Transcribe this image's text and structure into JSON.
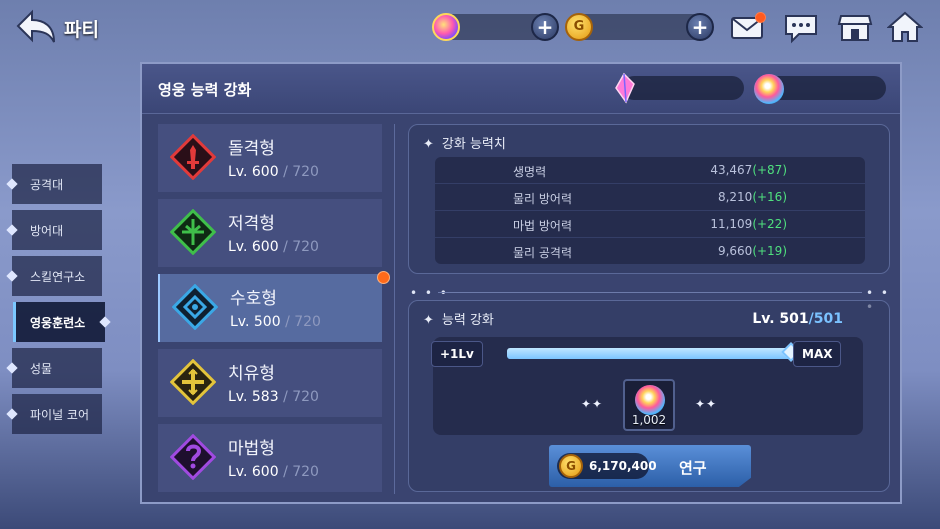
{
  "header": {
    "title": "파티",
    "currency_gold_icon": "G",
    "icons": [
      "back-arrow-icon",
      "gem-icon",
      "gold-coin-icon",
      "mail-icon",
      "chat-icon",
      "shop-icon",
      "home-icon"
    ]
  },
  "sidebar": {
    "items": [
      {
        "label": "공격대"
      },
      {
        "label": "방어대"
      },
      {
        "label": "스킬연구소"
      },
      {
        "label": "영웅훈련소",
        "active": true
      },
      {
        "label": "성물"
      },
      {
        "label": "파이널 코어"
      }
    ]
  },
  "panel": {
    "title": "영웅 능력 강화"
  },
  "classes": [
    {
      "name": "돌격형",
      "lv_prefix": "Lv. 600",
      "lv_max": " / 720",
      "icon": "sword-icon",
      "color": "#e23a3a"
    },
    {
      "name": "저격형",
      "lv_prefix": "Lv. 600",
      "lv_max": " / 720",
      "icon": "crosshair-icon",
      "color": "#3fbf4a"
    },
    {
      "name": "수호형",
      "lv_prefix": "Lv. 500",
      "lv_max": " / 720",
      "icon": "shield-icon",
      "color": "#3aa8e6",
      "active": true,
      "badge": true
    },
    {
      "name": "치유형",
      "lv_prefix": "Lv. 583",
      "lv_max": " / 720",
      "icon": "cross-icon",
      "color": "#e3c43b"
    },
    {
      "name": "마법형",
      "lv_prefix": "Lv. 600",
      "lv_max": " / 720",
      "icon": "magic-icon",
      "color": "#a04ae0"
    }
  ],
  "stats": {
    "title": "강화 능력치",
    "rows": [
      {
        "name": "생명력",
        "value": "43,467",
        "bonus": "(+87)"
      },
      {
        "name": "물리 방어력",
        "value": "8,210",
        "bonus": "(+16)"
      },
      {
        "name": "마법 방어력",
        "value": "11,109",
        "bonus": "(+22)"
      },
      {
        "name": "물리 공격력",
        "value": "9,660",
        "bonus": "(+19)"
      }
    ]
  },
  "upgrade": {
    "title": "능력 강화",
    "level_current": "Lv. 501",
    "level_max": "/501",
    "step_button": "+1Lv",
    "max_button": "MAX",
    "progress": 1.0,
    "material_count": "1,002",
    "cost": "6,170,400",
    "research_label": "연구",
    "coin_label": "G"
  },
  "decor": {
    "dots": "• • •",
    "sparkle": "✦✦",
    "star": "✦"
  }
}
